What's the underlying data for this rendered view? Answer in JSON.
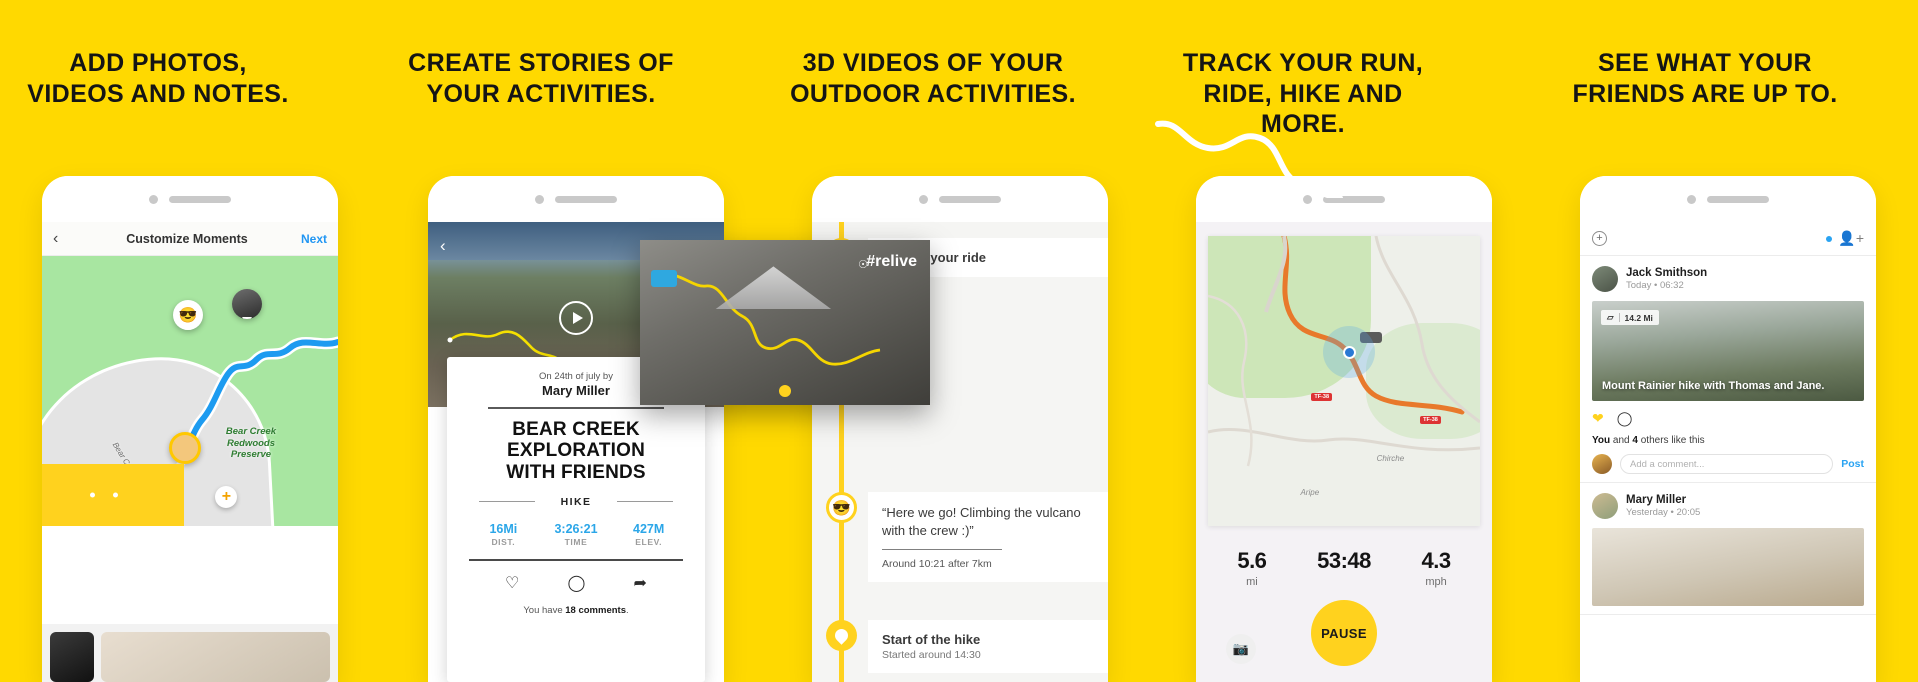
{
  "page": {
    "background_color": "#FFD900",
    "accent_yellow": "#FFD21E",
    "accent_blue": "#2BA6E8",
    "brand": "#relive"
  },
  "columns": [
    {
      "heading": "ADD PHOTOS, VIDEOS AND NOTES."
    },
    {
      "heading": "CREATE STORIES OF YOUR ACTIVITIES."
    },
    {
      "heading": "3D VIDEOS OF YOUR OUTDOOR ACTIVITIES."
    },
    {
      "heading": "TRACK YOUR RUN, RIDE, HIKE AND MORE."
    },
    {
      "heading": "SEE WHAT YOUR FRIENDS ARE UP TO."
    }
  ],
  "phone1": {
    "nav": {
      "back": "‹",
      "title": "Customize Moments",
      "next": "Next"
    },
    "map": {
      "park_label": "Bear Creek\nRedwoods\nPreserve",
      "park_label_l1": "Bear Creek",
      "park_label_l2": "Redwoods",
      "park_label_l3": "Preserve",
      "road_label": "Bear Creek Rd",
      "moment_emoji": "😎",
      "add_moment": "+"
    }
  },
  "phone2": {
    "hero": {
      "back": "‹",
      "more": "•••",
      "play": "play-button"
    },
    "card": {
      "subtitle": "On 24th of july by",
      "author": "Mary Miller",
      "title_line1": "BEAR CREEK",
      "title_line2": "EXPLORATION",
      "title_line3": "WITH FRIENDS",
      "activity_type": "HIKE",
      "stats": [
        {
          "value": "16Mi",
          "key": "DIST."
        },
        {
          "value": "3:26:21",
          "key": "TIME"
        },
        {
          "value": "427M",
          "key": "ELEV."
        }
      ],
      "actions": [
        "heart-icon",
        "comment-icon",
        "share-icon"
      ],
      "comments_prefix": "You have ",
      "comments_count": "18 comments",
      "comments_suffix": "."
    }
  },
  "phone3": {
    "event1": {
      "title": "Started your ride"
    },
    "video": {
      "brand": "#relive",
      "location_icon": "location-pin-icon"
    },
    "moment": {
      "emoji": "😎",
      "quote": "“Here we go! Climbing the vulcano with the crew :)”",
      "meta": "Around 10:21 after 7km"
    },
    "event2": {
      "title": "Start of the hike",
      "subtitle": "Started around 14:30"
    }
  },
  "phone4": {
    "map": {
      "place1": "Chirche",
      "place2": "Aripe",
      "shield1": "TF-38",
      "shield2": "TF-38"
    },
    "stats": [
      {
        "value": "5.6",
        "unit": "mi"
      },
      {
        "value": "53:48",
        "unit": ""
      },
      {
        "value": "4.3",
        "unit": "mph"
      }
    ],
    "camera_button": "📷",
    "pause_button": "PAUSE"
  },
  "phone5": {
    "toolbar": {
      "add": "+",
      "add_friend": "add-friend-icon"
    },
    "posts": [
      {
        "name": "Jack Smithson",
        "time": "Today • 06:32",
        "distance": "14.2 Mi",
        "caption": "Mount Rainier hike with Thomas and Jane.",
        "likes_prefix": "You",
        "likes_mid": " and ",
        "likes_count": "4",
        "likes_suffix": " others like this",
        "comment_placeholder": "Add a comment...",
        "post_label": "Post"
      },
      {
        "name": "Mary Miller",
        "time": "Yesterday • 20:05"
      }
    ]
  }
}
